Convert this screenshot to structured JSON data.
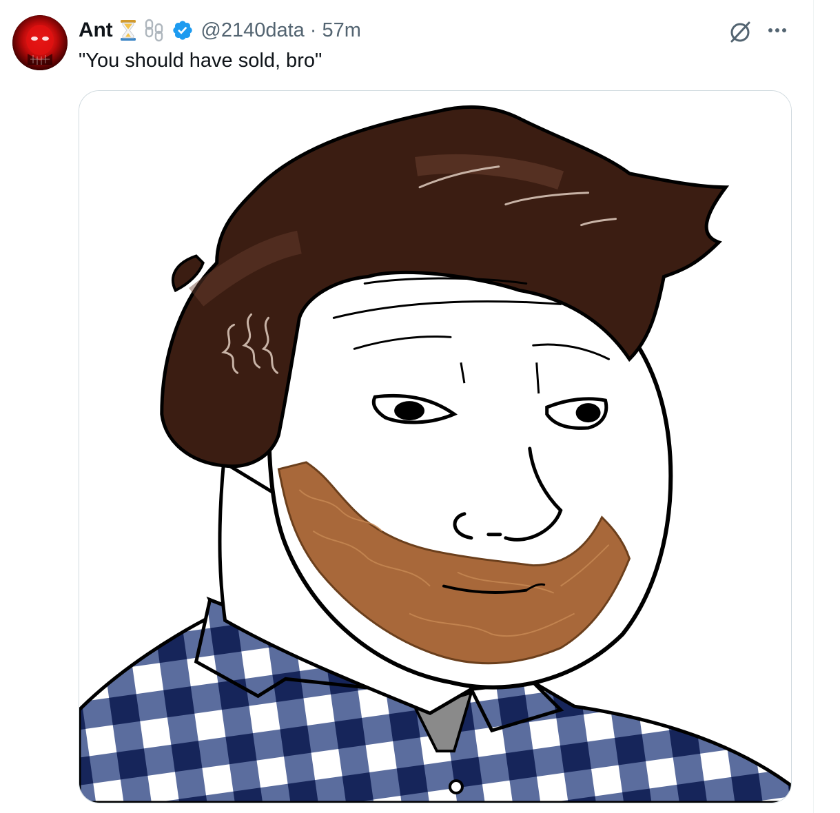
{
  "tweet": {
    "author_name": "Ant",
    "handle": "@2140data",
    "separator": "·",
    "time": "57m",
    "text": "\"You should have sold, bro\""
  },
  "icons": {
    "hourglass": "hourglass-icon",
    "chain": "chain-link-icon",
    "verified": "verified-badge-icon",
    "grok": "grok-icon",
    "more": "more-options-icon"
  },
  "colors": {
    "verified_blue": "#1d9bf0",
    "text_primary": "#0f1419",
    "text_secondary": "#536471",
    "hair": "#3b1d12",
    "beard": "#a8683a",
    "shirt_navy": "#1f3268"
  }
}
